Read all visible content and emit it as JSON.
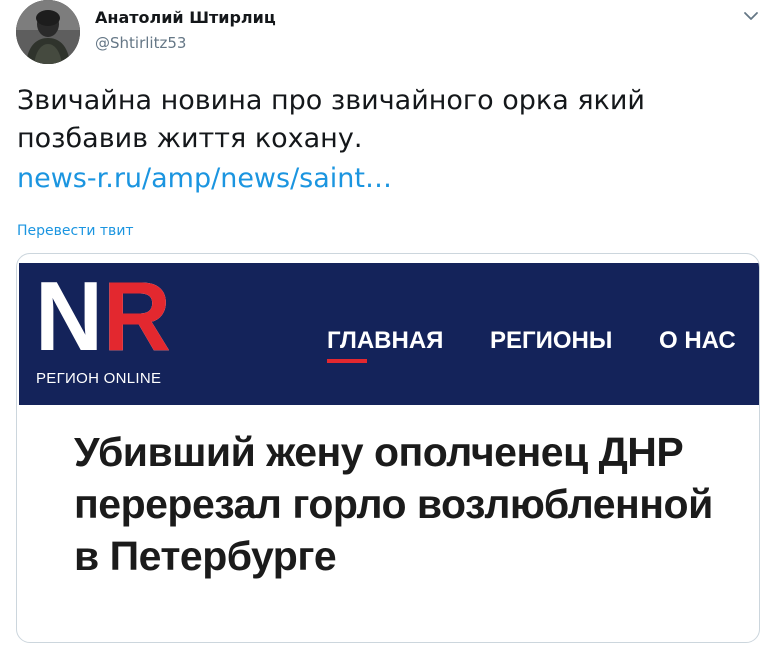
{
  "author": {
    "name": "Анатолий Штирлиц",
    "handle": "@Shtirlitz53"
  },
  "tweet": {
    "text": "Звичайна новина про звичайного орка який позбавив життя кохану.",
    "link": "news-r.ru/amp/news/saint…",
    "translate_label": "Перевести твит"
  },
  "card": {
    "logo_letters": "NR",
    "logo_sub": "РЕГИОН ONLINE",
    "nav": [
      "ГЛАВНАЯ",
      "РЕГИОНЫ",
      "О НАС"
    ],
    "headline": "Убивший жену ополченец ДНР перерезал горло возлюбленной в Петербурге",
    "colors": {
      "header_bg": "#14235a",
      "accent_red": "#e3282f",
      "link_blue": "#1b95e0"
    }
  },
  "icons": {
    "menu": "chevron-down-icon"
  }
}
